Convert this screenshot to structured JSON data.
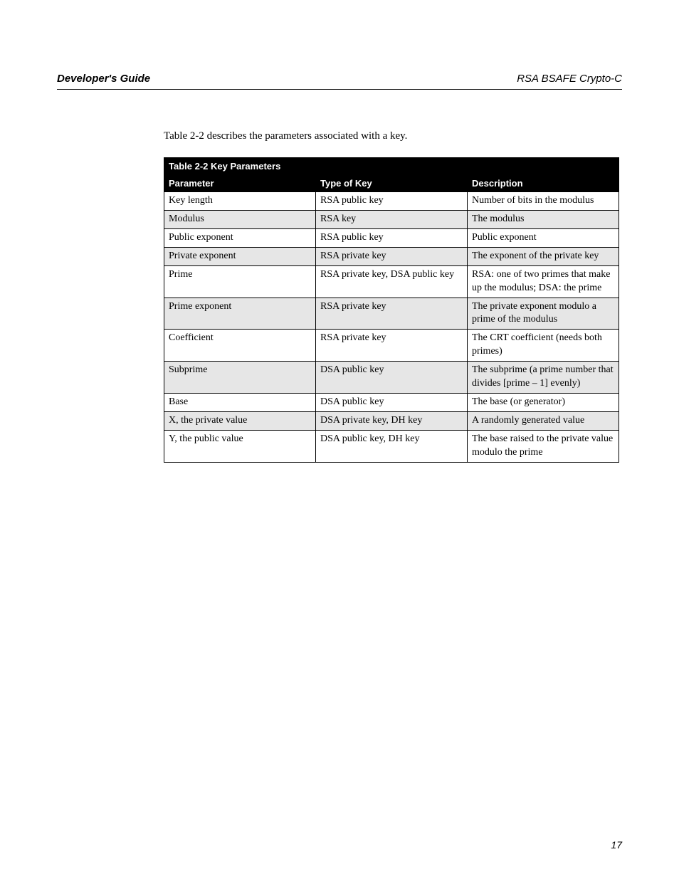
{
  "header": {
    "left": "Developer's Guide",
    "right": "RSA BSAFE Crypto-C"
  },
  "intro_text": "Table 2-2 describes the parameters associated with a key.",
  "table": {
    "caption_label": "Table 2-2",
    "caption_text": "Key Parameters",
    "headers": [
      "Parameter",
      "Type of Key",
      "Description"
    ],
    "rows": [
      {
        "shade": false,
        "cells": [
          "Key length",
          "RSA public key",
          "Number of bits in the modulus"
        ]
      },
      {
        "shade": true,
        "cells": [
          "Modulus",
          "RSA key",
          "The modulus"
        ]
      },
      {
        "shade": false,
        "cells": [
          "Public exponent",
          "RSA public key",
          "Public exponent"
        ]
      },
      {
        "shade": true,
        "cells": [
          "Private exponent",
          "RSA private key",
          "The exponent of the private key"
        ]
      },
      {
        "shade": false,
        "cells": [
          "Prime",
          "RSA private key, DSA public key",
          "RSA: one of two primes that make up the modulus; DSA: the prime"
        ]
      },
      {
        "shade": true,
        "cells": [
          "Prime exponent",
          "RSA private key",
          "The private exponent modulo a prime of the modulus"
        ]
      },
      {
        "shade": false,
        "cells": [
          "Coefficient",
          "RSA private key",
          "The CRT coefficient (needs both primes)"
        ]
      },
      {
        "shade": true,
        "cells": [
          "Subprime",
          "DSA public key",
          "The subprime (a prime number that divides [prime – 1] evenly)"
        ]
      },
      {
        "shade": false,
        "cells": [
          "Base",
          "DSA public key",
          "The base (or generator)"
        ]
      },
      {
        "shade": true,
        "cells": [
          "X, the private value",
          "DSA private key, DH key",
          "A randomly generated value"
        ]
      },
      {
        "shade": false,
        "cells": [
          "Y, the public value",
          "DSA public key, DH key",
          "The base raised to the private value modulo the prime"
        ]
      }
    ]
  },
  "page_number": "17"
}
